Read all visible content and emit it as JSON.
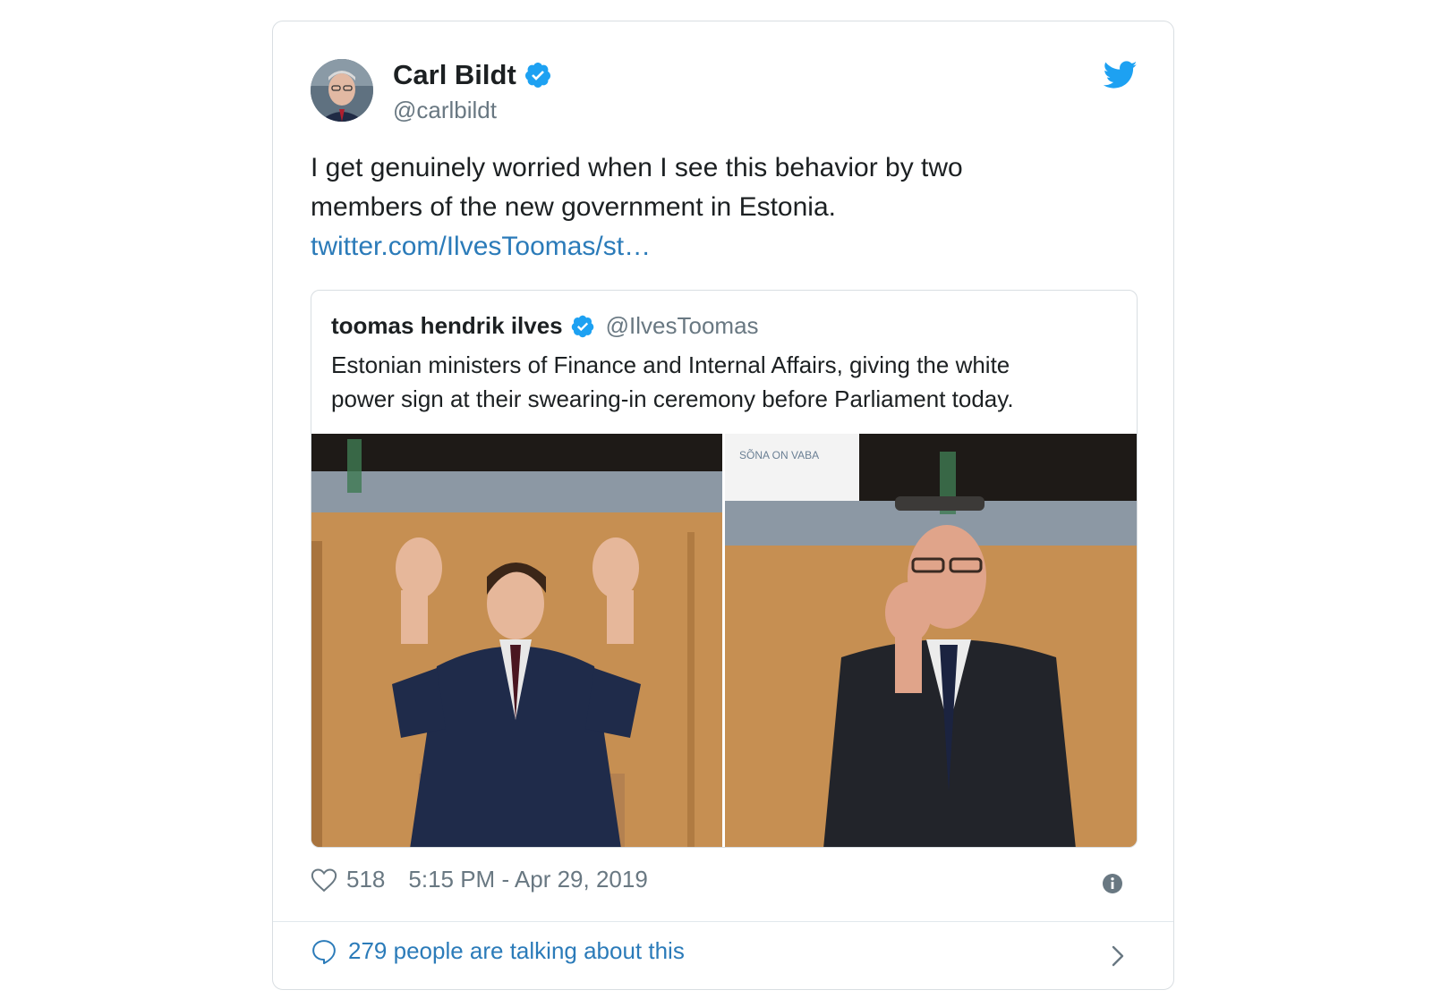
{
  "author": {
    "display_name": "Carl Bildt",
    "handle": "@carlbildt",
    "avatar_icon": "avatar-photo",
    "verified_icon": "verified-badge-icon"
  },
  "tweet": {
    "text_line1": "I get genuinely worried when I see this behavior by two",
    "text_line2": "members of the new government in Estonia.",
    "link": "twitter.com/IlvesToomas/st…"
  },
  "quoted_tweet": {
    "display_name": "toomas hendrik ilves",
    "handle": "@IlvesToomas",
    "text_line1": "Estonian ministers of Finance and Internal Affairs, giving the white",
    "text_line2": "power sign at their swearing-in ceremony before Parliament today.",
    "photo_left_caption_icon": "photo-minister-1",
    "photo_right_caption_icon": "photo-minister-2",
    "photo_right_shirt_text": "SÕNA ON VABA"
  },
  "meta": {
    "likes": "518",
    "timestamp": "5:15 PM - Apr 29, 2019"
  },
  "footer": {
    "conversation_text": "279 people are talking about this"
  },
  "colors": {
    "link_blue": "#2b7bb9",
    "twitter_blue": "#1da1f2",
    "text": "#1c2022",
    "muted": "#697882",
    "border": "#d9dee2"
  }
}
